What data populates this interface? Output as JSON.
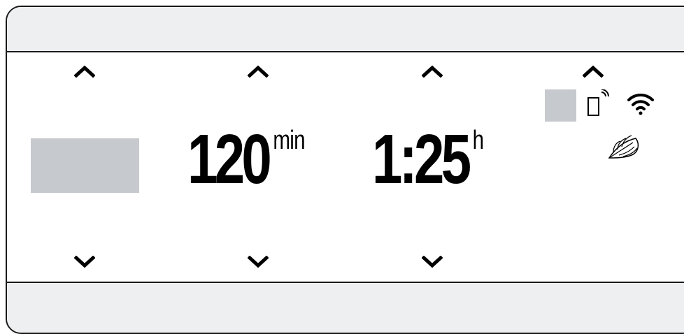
{
  "display": {
    "duration": {
      "value": "120",
      "unit": "min"
    },
    "time": {
      "value": "1:25",
      "unit": "h"
    }
  },
  "status_icons": [
    "remote-start-icon",
    "wifi-icon",
    "feather-icon"
  ],
  "colors": {
    "frame": "#1a1a1a",
    "band": "#eeeff1",
    "placeholder": "#c6c9cd",
    "text": "#000000"
  }
}
